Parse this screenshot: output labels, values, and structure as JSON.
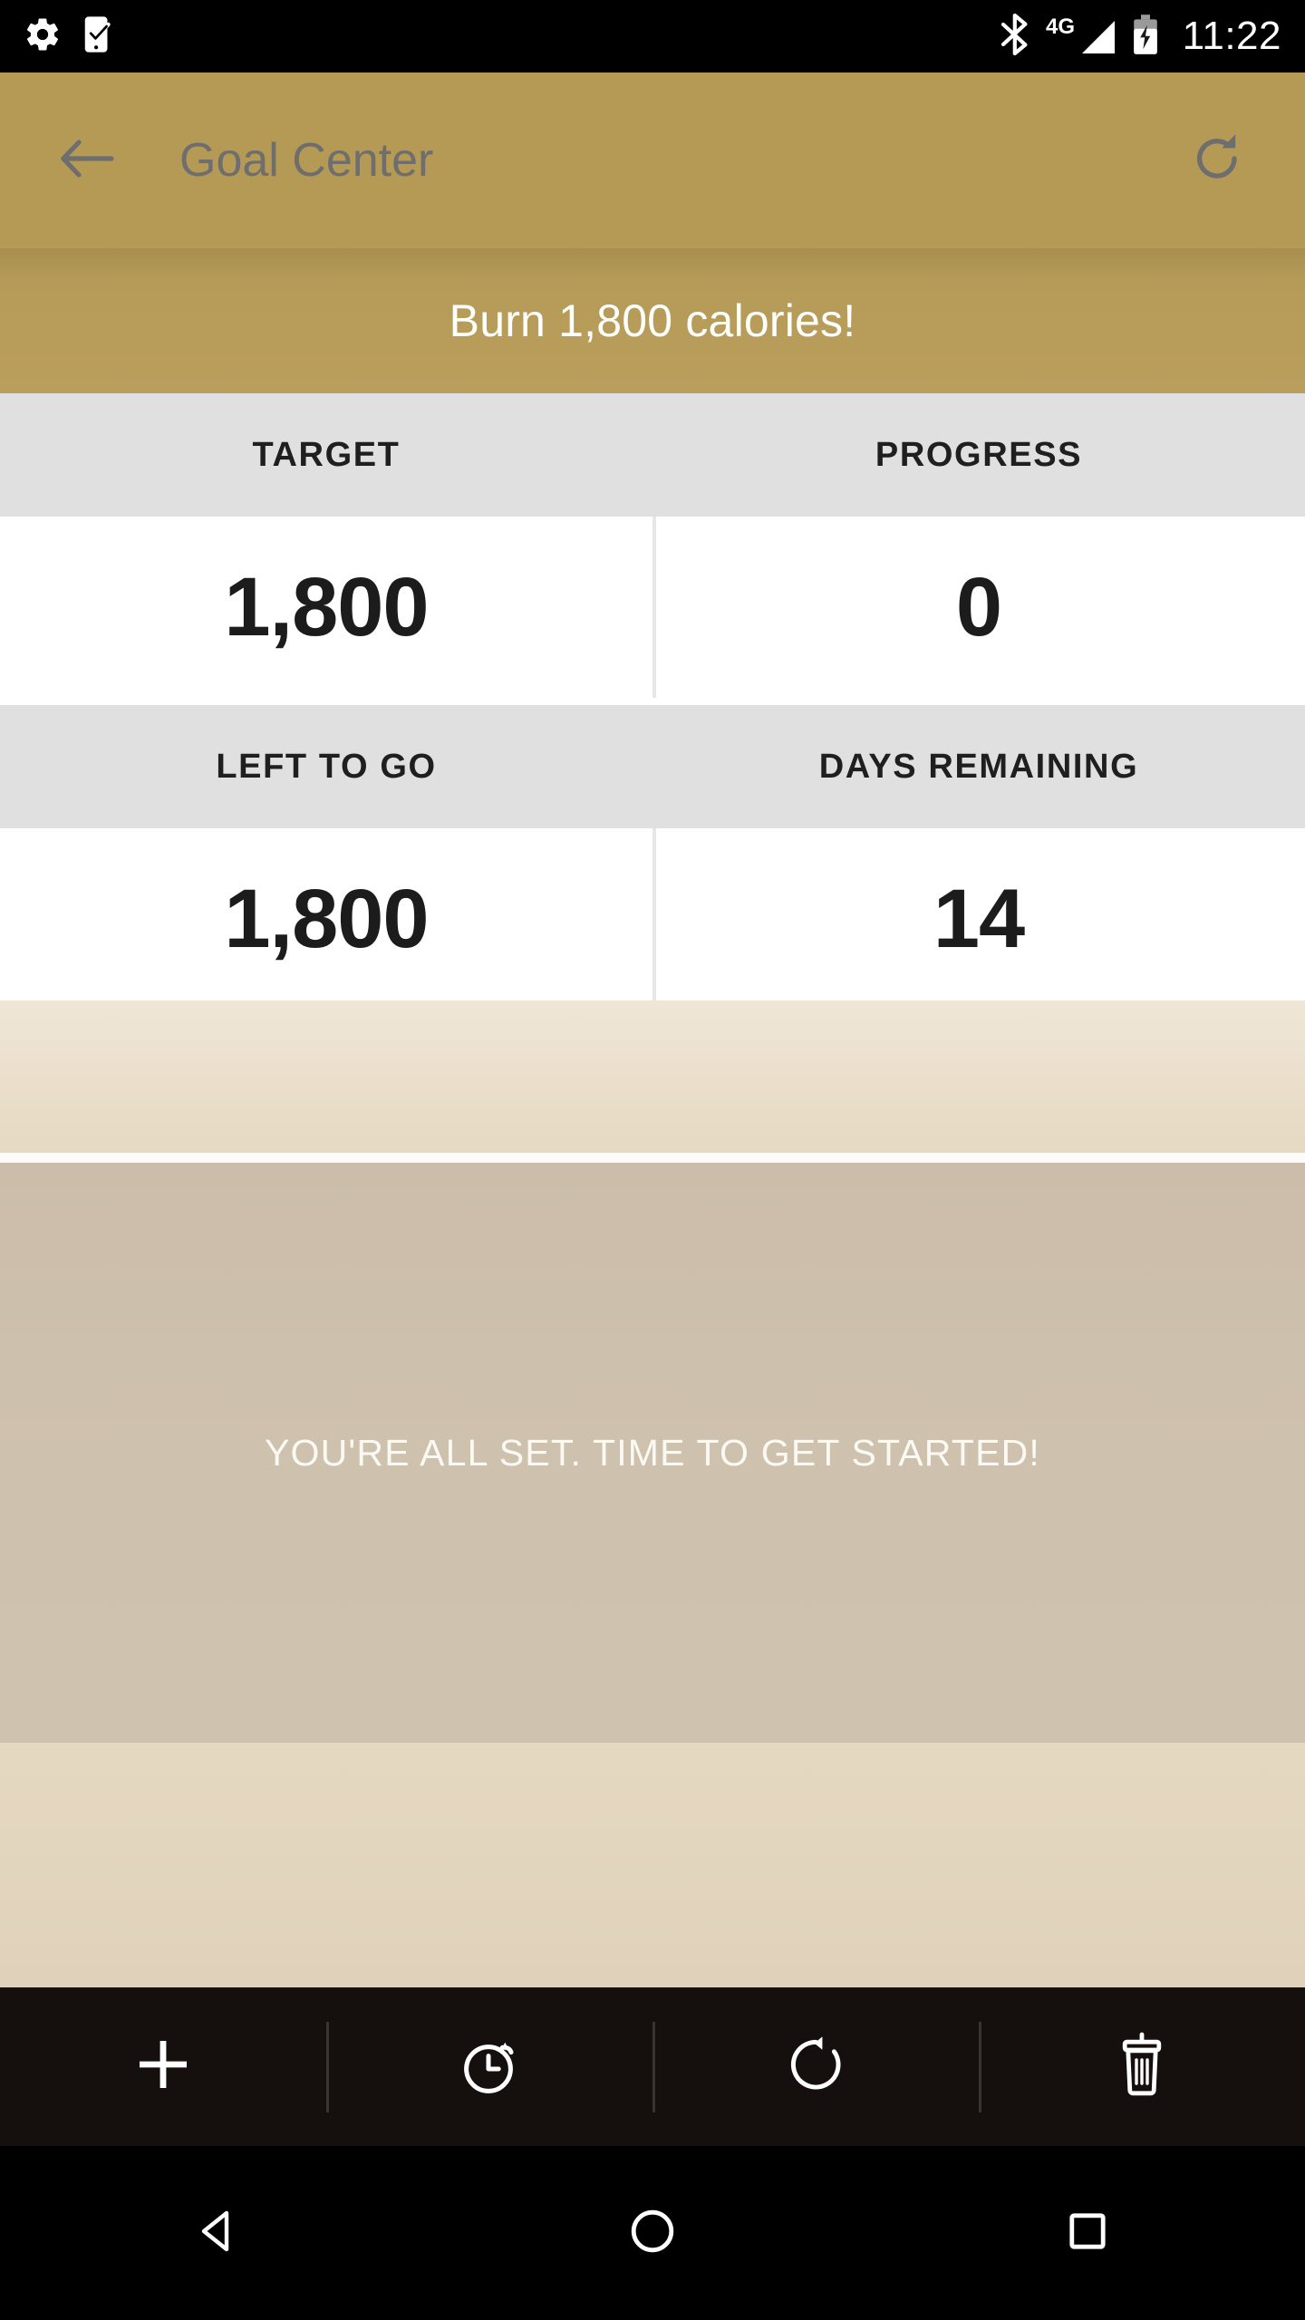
{
  "status_bar": {
    "left_icons": [
      {
        "name": "settings-gear-icon",
        "label": "Settings"
      },
      {
        "name": "phone-checkmark-icon",
        "label": "Device check"
      }
    ],
    "right_icons": [
      {
        "name": "bluetooth-icon",
        "label": "Bluetooth"
      },
      {
        "name": "network-4g-icon",
        "label": "4G"
      },
      {
        "name": "battery-charging-icon",
        "label": "Battery charging"
      }
    ],
    "network_label": "4G",
    "clock": "11:22",
    "background": "#000000"
  },
  "app_bar": {
    "title": "Goal Center",
    "back_icon": "arrow-left-icon",
    "refresh_icon": "refresh-icon",
    "background": "#b59a56",
    "title_color": "#6e6e6e"
  },
  "goal_banner": {
    "text": "Burn 1,800 calories!",
    "background": "#b59a56",
    "text_color": "#ffffff"
  },
  "stats": {
    "rows": [
      {
        "cells": [
          {
            "label": "TARGET",
            "value": "1,800"
          },
          {
            "label": "PROGRESS",
            "value": "0"
          }
        ]
      },
      {
        "cells": [
          {
            "label": "LEFT TO GO",
            "value": "1,800"
          },
          {
            "label": "DAYS REMAINING",
            "value": "14"
          }
        ]
      }
    ],
    "header_background": "#e0e0e0",
    "value_background": "#ffffff",
    "value_color": "#1c1c1c"
  },
  "message": {
    "text": "YOU'RE ALL SET. TIME TO GET STARTED!",
    "text_color": "#fbf9f4",
    "background": "#cec1ad"
  },
  "toolbar": {
    "background": "#150f0e",
    "buttons": [
      {
        "name": "add-button",
        "icon": "plus-icon",
        "label": "Add"
      },
      {
        "name": "timer-button",
        "icon": "alarm-clock-icon",
        "label": "Timer"
      },
      {
        "name": "reset-button",
        "icon": "rotate-ccw-icon",
        "label": "Reset"
      },
      {
        "name": "delete-button",
        "icon": "trash-icon",
        "label": "Delete"
      }
    ]
  },
  "nav_bar": {
    "background": "#000000",
    "buttons": [
      {
        "name": "nav-back-button",
        "icon": "triangle-left-icon",
        "label": "Back"
      },
      {
        "name": "nav-home-button",
        "icon": "circle-icon",
        "label": "Home"
      },
      {
        "name": "nav-recents-button",
        "icon": "square-icon",
        "label": "Recents"
      }
    ]
  }
}
